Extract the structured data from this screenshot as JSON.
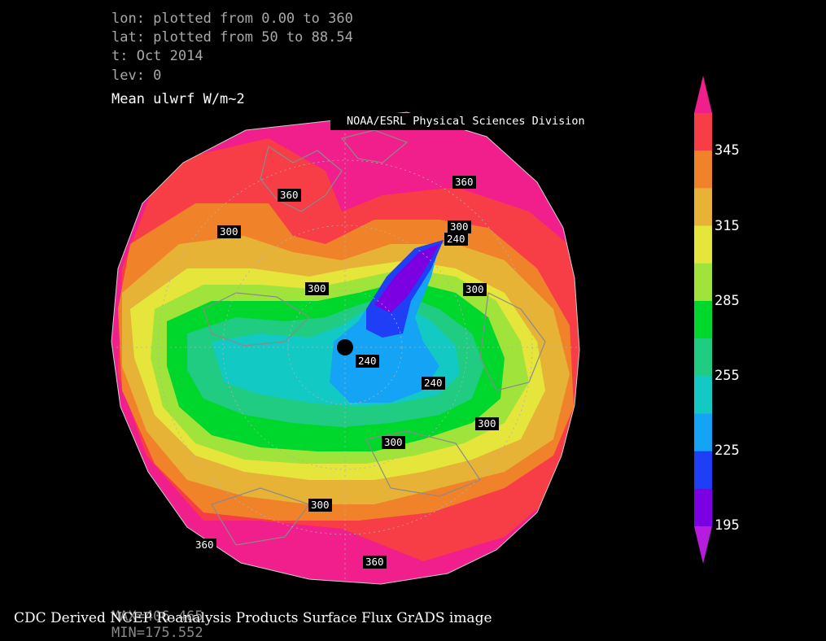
{
  "header": {
    "lon_line": "lon: plotted from 0.00 to 360",
    "lat_line": "lat: plotted from 50 to 88.54",
    "time_line": "t: Oct 2014",
    "lev_line": "lev: 0",
    "title": "Mean ulwrf W/m~2",
    "credit": "NOAA/ESRL Physical Sciences Division"
  },
  "map": {
    "projection": "north-polar-stereographic",
    "pole_marker": "filled-black-dot",
    "contour_labels": [
      "360",
      "360",
      "300",
      "300",
      "240",
      "300",
      "300",
      "240",
      "240",
      "300",
      "300",
      "300",
      "360",
      "360"
    ]
  },
  "colorbar": {
    "labels": [
      "345",
      "315",
      "285",
      "255",
      "225",
      "195"
    ],
    "colors": [
      "#f01f8c",
      "#f73d46",
      "#f0832a",
      "#e7b337",
      "#e6e53c",
      "#a0e43b",
      "#00d72c",
      "#1fcc82",
      "#13c9c4",
      "#15a4f5",
      "#1f3ff6",
      "#7b00e2",
      "#b61ce0"
    ]
  },
  "footer": {
    "text": "CDC Derived NCEP Reanalysis Products Surface Flux GrADS image",
    "max_text": "MAX=406.465",
    "min_text": "MIN=175.552"
  }
}
